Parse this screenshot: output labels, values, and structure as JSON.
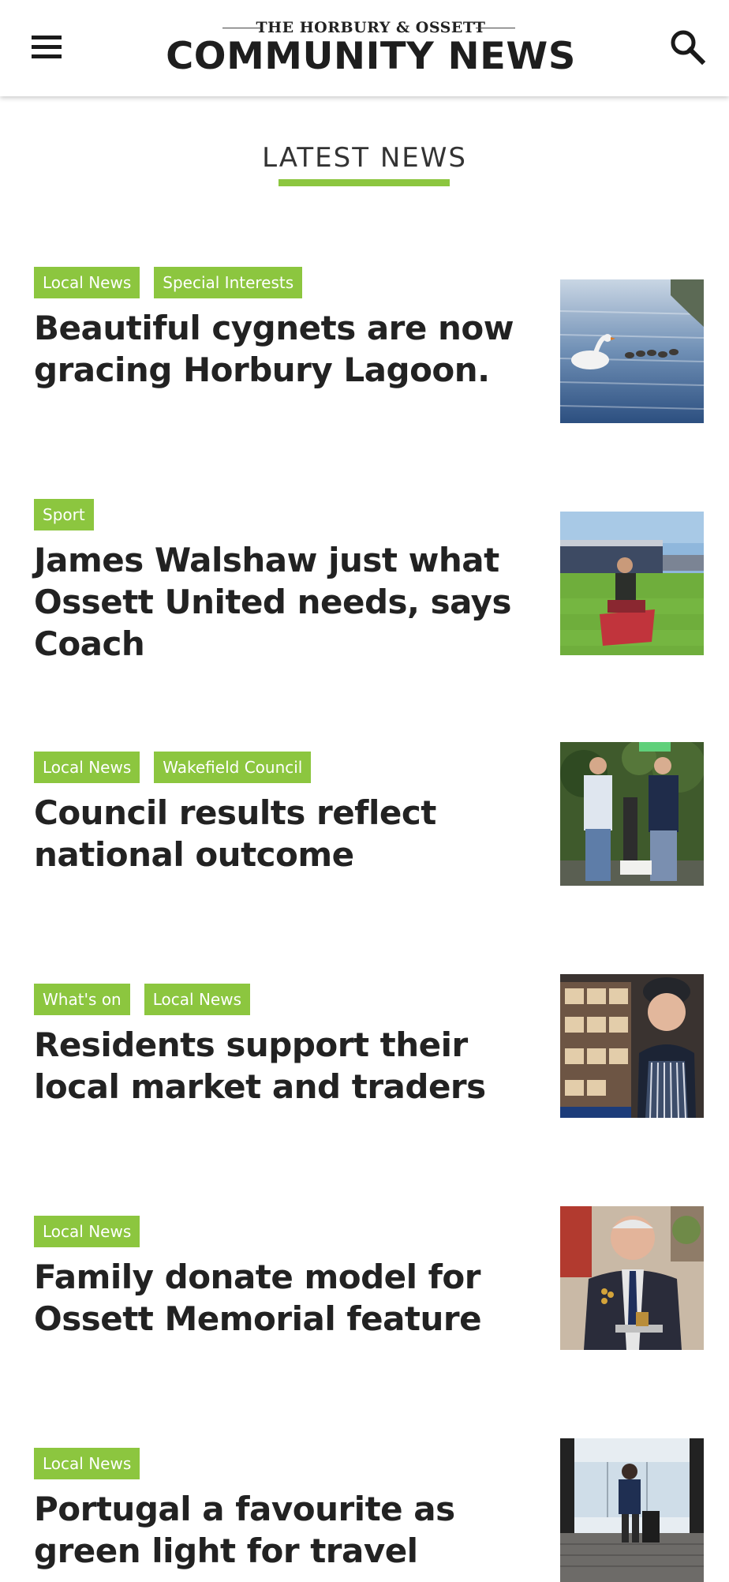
{
  "header": {
    "logo_top": "THE HORBURY & OSSETT",
    "logo_main": "COMMUNITY NEWS",
    "menu_icon": "hamburger-menu-icon",
    "search_icon": "search-icon"
  },
  "section": {
    "title": "LATEST NEWS"
  },
  "colors": {
    "accent": "#8cc63f",
    "headline": "#222222"
  },
  "articles": [
    {
      "tags": [
        "Local News",
        "Special Interests"
      ],
      "headline": "Beautiful cygnets are now gracing Horbury Lagoon."
    },
    {
      "tags": [
        "Sport"
      ],
      "headline": "James Walshaw just what Ossett United needs, says Coach"
    },
    {
      "tags": [
        "Local News",
        "Wakefield Council"
      ],
      "headline": "Council results reflect national outcome"
    },
    {
      "tags": [
        "What's on",
        "Local News"
      ],
      "headline": "Residents support their local market and traders"
    },
    {
      "tags": [
        "Local News"
      ],
      "headline": "Family donate model for Ossett Memorial feature"
    },
    {
      "tags": [
        "Local News"
      ],
      "headline": "Portugal a favourite as green light for travel"
    }
  ]
}
